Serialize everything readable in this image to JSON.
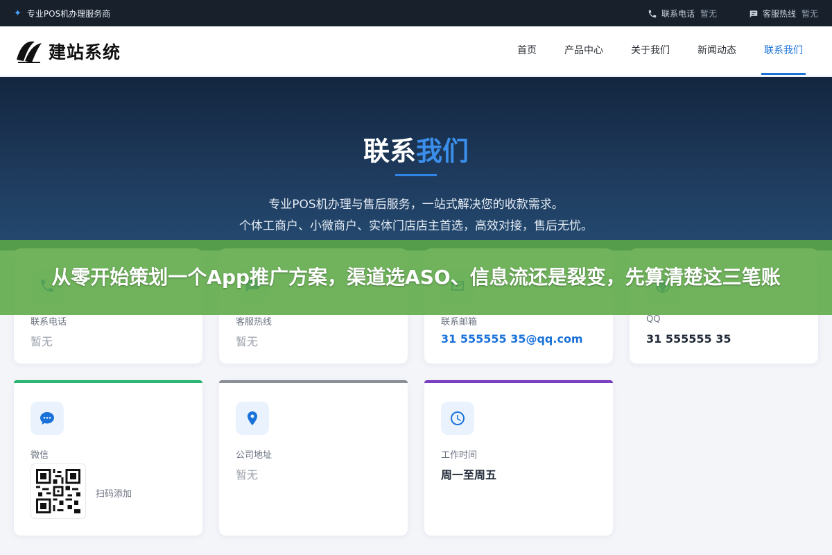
{
  "topbar": {
    "service_name": "专业POS机办理服务商",
    "phone_label": "联系电话",
    "phone_value": "暂无",
    "hotline_label": "客服热线",
    "hotline_value": "暂无"
  },
  "header": {
    "logo_text": "建站系统",
    "nav": [
      {
        "label": "首页"
      },
      {
        "label": "产品中心"
      },
      {
        "label": "关于我们"
      },
      {
        "label": "新闻动态"
      },
      {
        "label": "联系我们",
        "active": true
      }
    ]
  },
  "hero": {
    "title_plain": "联系",
    "title_highlight": "我们",
    "subtitle_line1": "专业POS机办理与售后服务，一站式解决您的收款需求。",
    "subtitle_line2": "个体工商户、小微商户、实体门店店主首选，高效对接，售后无忧。"
  },
  "banner": {
    "text": "从零开始策划一个App推广方案，渠道选ASO、信息流还是裂变，先算清楚这三笔账"
  },
  "cards": {
    "phone": {
      "label": "联系电话",
      "value": "暂无",
      "icon": "phone-icon"
    },
    "hotline": {
      "label": "客服热线",
      "value": "暂无",
      "icon": "chat-icon"
    },
    "email": {
      "label": "联系邮箱",
      "value": "31 555555 35@qq.com",
      "icon": "mail-icon"
    },
    "qq": {
      "label": "QQ",
      "value": "31 555555 35",
      "icon": "globe-icon"
    },
    "wechat": {
      "label": "微信",
      "qr_hint": "扫码添加",
      "icon": "wechat-icon",
      "accent": "#2bb673"
    },
    "address": {
      "label": "公司地址",
      "value": "暂无",
      "icon": "location-icon",
      "accent": "#8a8f98"
    },
    "hours": {
      "label": "工作时间",
      "value": "周一至周五",
      "icon": "clock-icon",
      "accent": "#7a3fbf"
    }
  },
  "colors": {
    "brand_blue": "#1a72d9",
    "topbar_bg": "#18202c",
    "banner_green": "#5ca846"
  }
}
